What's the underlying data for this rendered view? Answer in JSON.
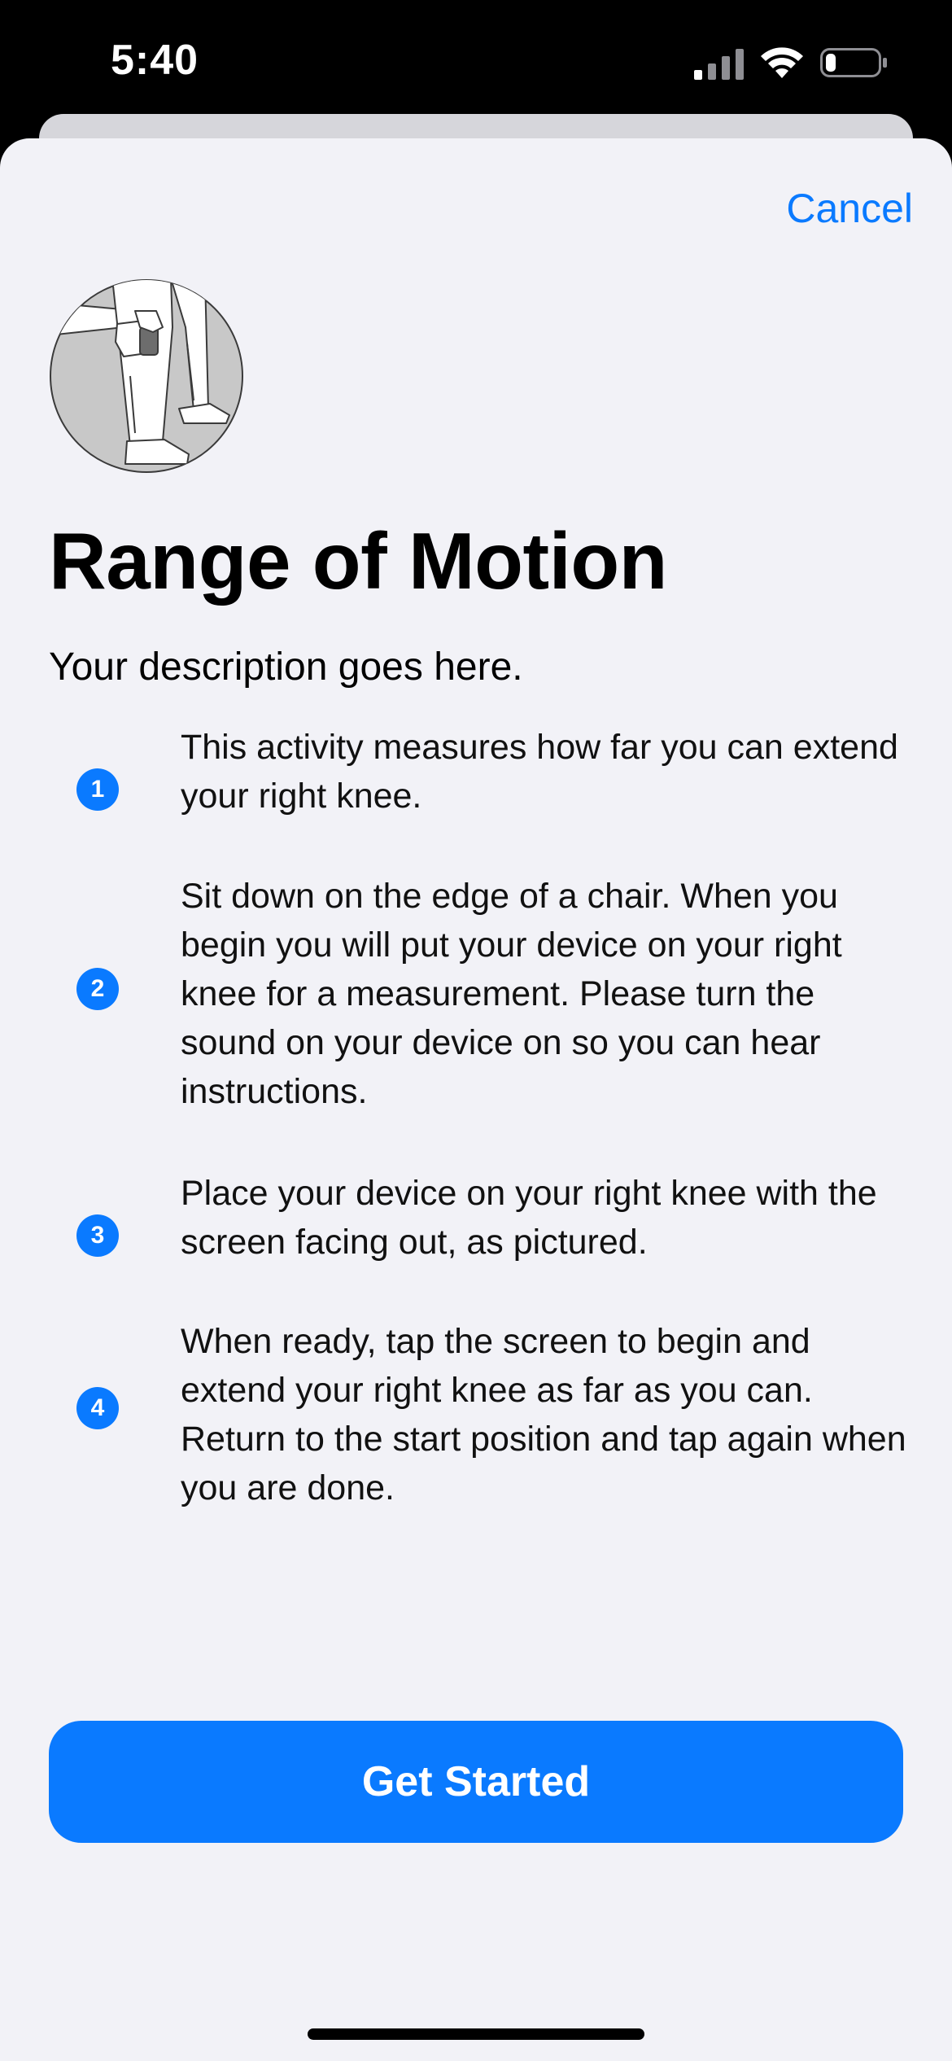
{
  "status_bar": {
    "time": "5:40",
    "signal_icon": "cellular-signal-icon",
    "wifi_icon": "wifi-icon",
    "battery_icon": "battery-icon",
    "battery_level": 0.2
  },
  "header": {
    "cancel_label": "Cancel"
  },
  "illustration": {
    "icon": "knee-device-illustration"
  },
  "content": {
    "title": "Range of Motion",
    "description": "Your description goes here.",
    "steps": [
      {
        "number": "1",
        "text": "This activity measures how far you can extend your right knee."
      },
      {
        "number": "2",
        "text": "Sit down on the edge of a chair. When you begin you will put your device on your right knee for a measurement. Please turn the sound on your device on so you can hear instructions."
      },
      {
        "number": "3",
        "text": "Place your device on your right knee with the screen facing out, as pictured."
      },
      {
        "number": "4",
        "text": "When ready, tap the screen to begin and extend your right knee as far as you can. Return to the start position and tap again when you are done."
      }
    ]
  },
  "actions": {
    "primary_label": "Get Started"
  },
  "colors": {
    "accent": "#0a7aff",
    "sheet_background": "#f2f2f7",
    "status_bar_background": "#000000"
  }
}
